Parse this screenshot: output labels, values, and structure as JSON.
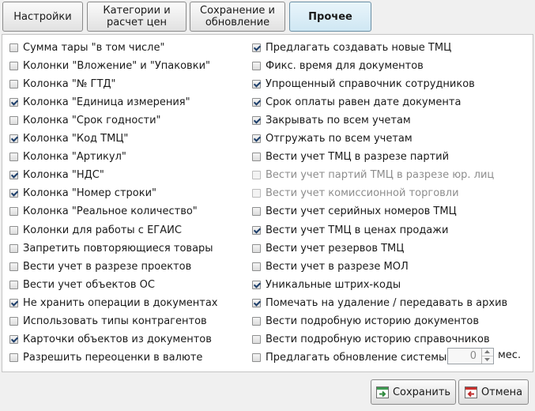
{
  "tabs": [
    {
      "label": "Настройки",
      "active": false
    },
    {
      "label": "Категории и\nрасчет цен",
      "active": false
    },
    {
      "label": "Сохранение и\nобновление",
      "active": false
    },
    {
      "label": "Прочее",
      "active": true
    }
  ],
  "left_options": [
    {
      "label": "Сумма тары \"в том числе\"",
      "checked": false
    },
    {
      "label": "Колонки \"Вложение\" и \"Упаковки\"",
      "checked": false
    },
    {
      "label": "Колонка \"№ ГТД\"",
      "checked": false
    },
    {
      "label": "Колонка \"Единица измерения\"",
      "checked": true
    },
    {
      "label": "Колонка \"Срок годности\"",
      "checked": false
    },
    {
      "label": "Колонка \"Код ТМЦ\"",
      "checked": true
    },
    {
      "label": "Колонка \"Артикул\"",
      "checked": false
    },
    {
      "label": "Колонка \"НДС\"",
      "checked": true
    },
    {
      "label": "Колонка \"Номер строки\"",
      "checked": true
    },
    {
      "label": "Колонка \"Реальное количество\"",
      "checked": false
    },
    {
      "label": "Колонки для работы с ЕГАИС",
      "checked": false
    },
    {
      "label": "Запретить повторяющиеся товары",
      "checked": false
    },
    {
      "label": "Вести учет в разрезе  проектов",
      "checked": false
    },
    {
      "label": "Вести учет объектов ОС",
      "checked": false
    },
    {
      "label": "Не хранить операции в документах",
      "checked": true
    },
    {
      "label": "Использовать типы контрагентов",
      "checked": false
    },
    {
      "label": "Карточки объектов из документов",
      "checked": true
    },
    {
      "label": "Разрешить переоценки в валюте",
      "checked": false
    }
  ],
  "right_options": [
    {
      "label": "Предлагать создавать новые ТМЦ",
      "checked": true,
      "disabled": false
    },
    {
      "label": "Фикс. время для документов",
      "checked": false,
      "disabled": false
    },
    {
      "label": "Упрощенный справочник сотрудников",
      "checked": true,
      "disabled": false
    },
    {
      "label": "Срок оплаты равен дате документа",
      "checked": true,
      "disabled": false
    },
    {
      "label": "Закрывать по всем учетам",
      "checked": true,
      "disabled": false
    },
    {
      "label": "Отгружать по всем учетам",
      "checked": true,
      "disabled": false
    },
    {
      "label": "Вести учет ТМЦ в разрезе партий",
      "checked": false,
      "disabled": false
    },
    {
      "label": "Вести учет партий ТМЦ в разрезе юр. лиц",
      "checked": false,
      "disabled": true
    },
    {
      "label": "Вести учет комиссионной торговли",
      "checked": false,
      "disabled": true
    },
    {
      "label": "Вести учет серийных номеров ТМЦ",
      "checked": false,
      "disabled": false
    },
    {
      "label": "Вести учет ТМЦ в ценах продажи",
      "checked": true,
      "disabled": false
    },
    {
      "label": "Вести учет резервов ТМЦ",
      "checked": false,
      "disabled": false
    },
    {
      "label": "Вести учет в разрезе МОЛ",
      "checked": false,
      "disabled": false
    },
    {
      "label": "Уникальные штрих-коды",
      "checked": true,
      "disabled": false
    },
    {
      "label": "Помечать на удаление / передавать в архив",
      "checked": true,
      "disabled": false
    },
    {
      "label": "Вести подробную историю документов",
      "checked": false,
      "disabled": false
    },
    {
      "label": "Вести подробную историю справочников",
      "checked": false,
      "disabled": false
    },
    {
      "label": "Предлагать обновление системы",
      "checked": false,
      "disabled": false
    }
  ],
  "update_interval": {
    "value": "0",
    "unit": "мес."
  },
  "buttons": {
    "save_label": "Сохранить",
    "cancel_label": "Отмена"
  },
  "icons": {
    "save": "save-icon",
    "cancel": "cancel-icon",
    "spin_up": "arrow-up-icon",
    "spin_down": "arrow-down-icon"
  }
}
